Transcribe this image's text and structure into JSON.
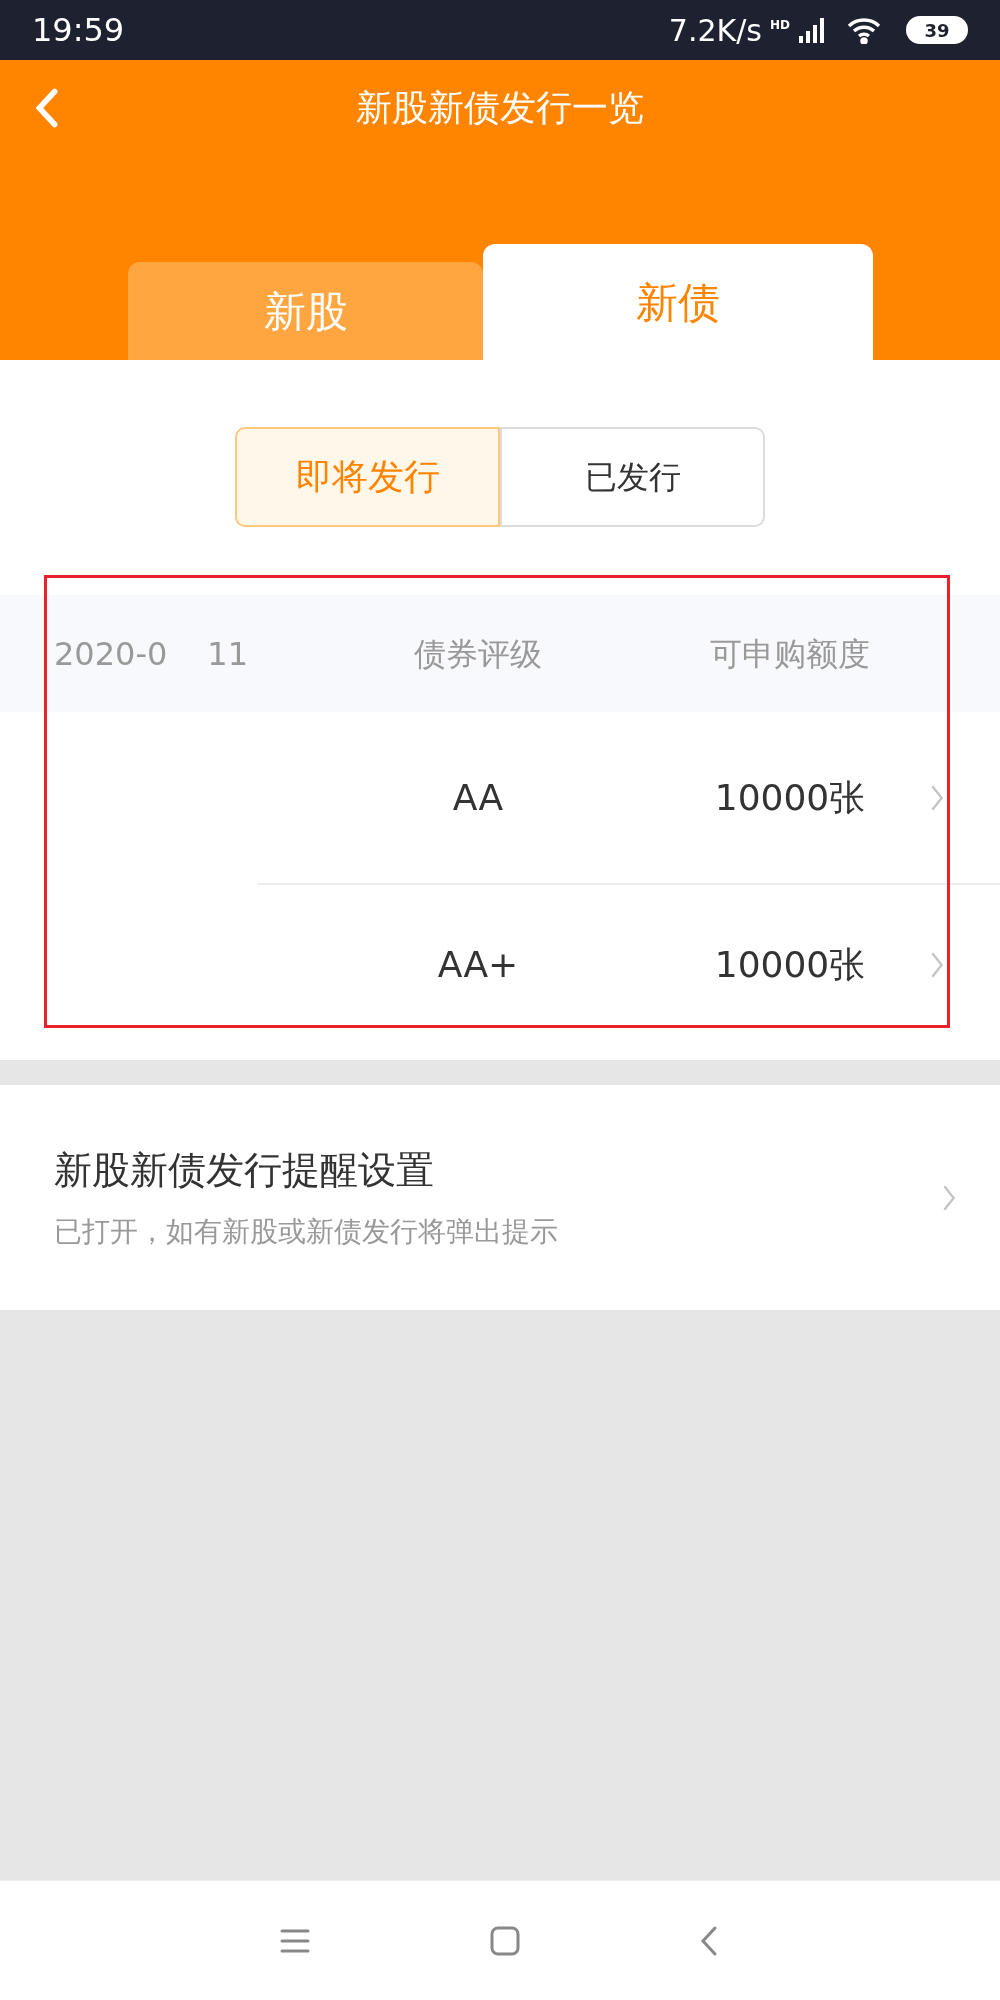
{
  "status_bar": {
    "time": "19:59",
    "speed": "7.2K/s",
    "network": "HD",
    "battery": "39"
  },
  "header": {
    "title": "新股新债发行一览"
  },
  "tabs": [
    {
      "label": "新股",
      "selected": false
    },
    {
      "label": "新债",
      "selected": true
    }
  ],
  "segments": [
    {
      "label": "即将发行",
      "selected": true
    },
    {
      "label": "已发行",
      "selected": false
    }
  ],
  "table": {
    "date_start": "2020-0",
    "date_end": "11",
    "columns": [
      "债券评级",
      "可申购额度"
    ],
    "rows": [
      {
        "rating": "AA",
        "quota": "10000张"
      },
      {
        "rating": "AA+",
        "quota": "10000张"
      }
    ]
  },
  "reminder": {
    "title": "新股新债发行提醒设置",
    "subtitle": "已打开，如有新股或新债发行将弹出提示"
  }
}
